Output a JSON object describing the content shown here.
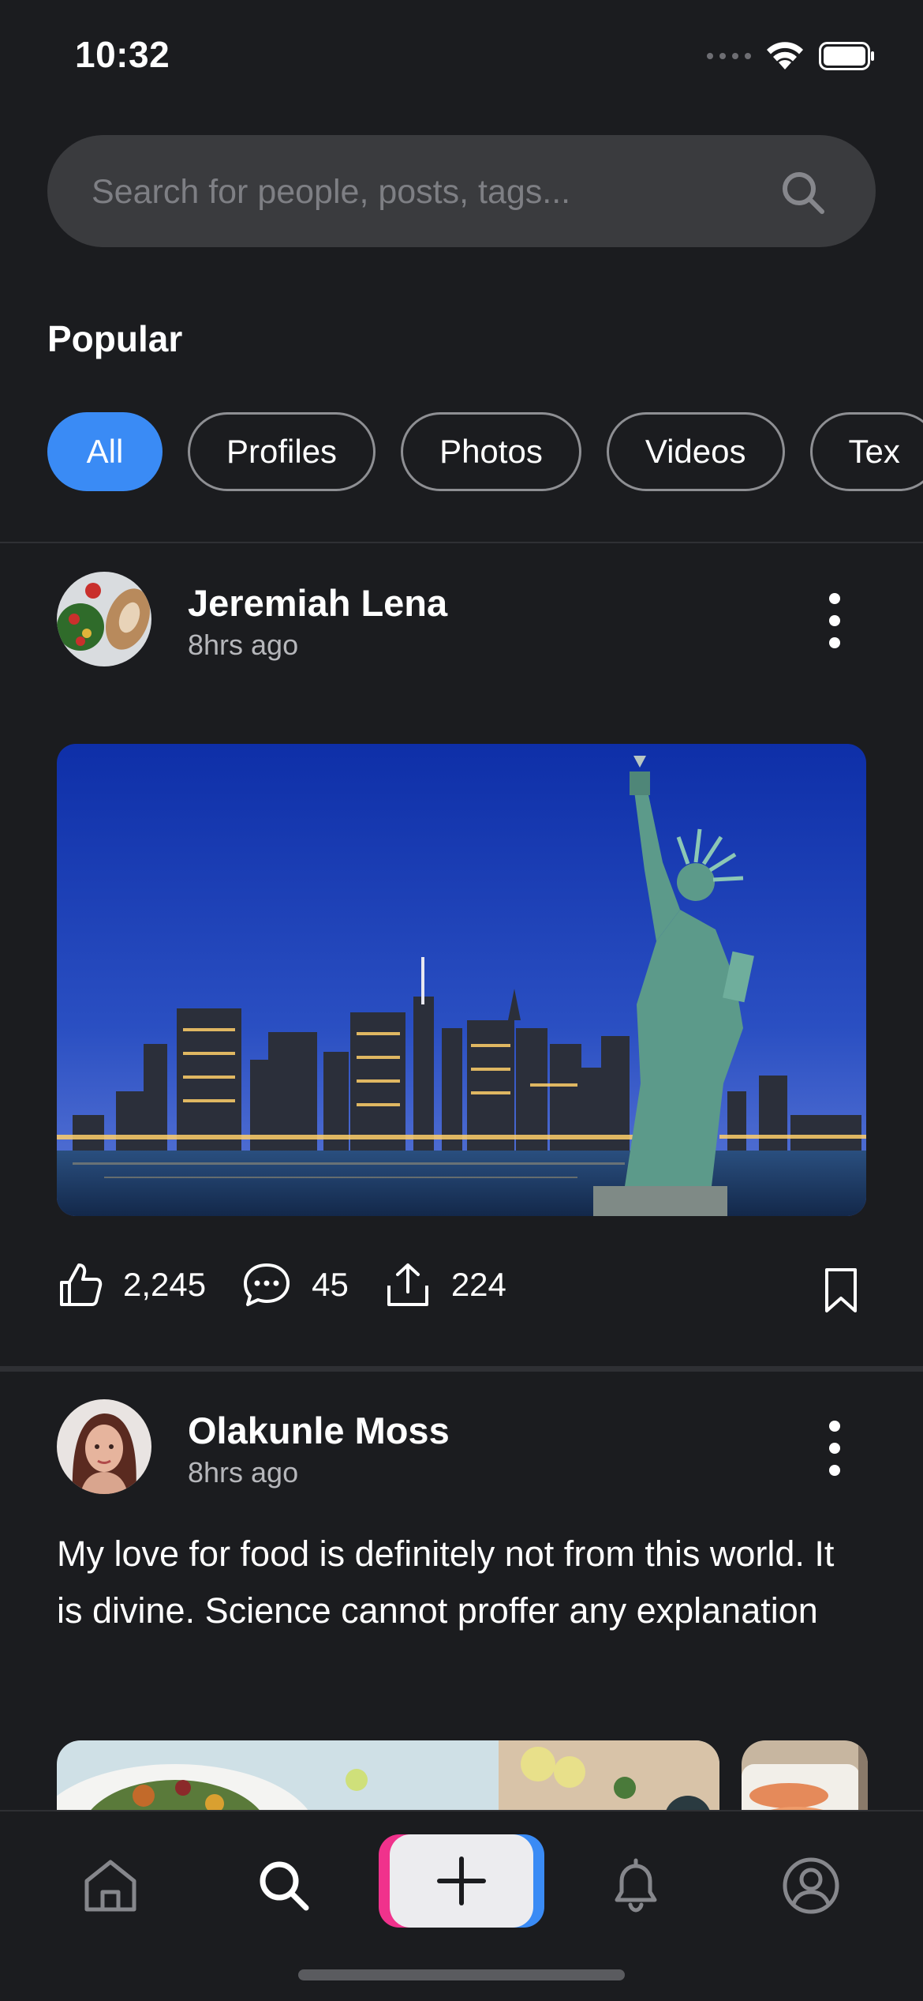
{
  "status_bar": {
    "time": "10:32"
  },
  "search": {
    "placeholder": "Search for people, posts, tags..."
  },
  "popular": {
    "title": "Popular",
    "filters": [
      "All",
      "Profiles",
      "Photos",
      "Videos",
      "Tex"
    ],
    "active_filter": "All"
  },
  "posts": [
    {
      "author": "Jeremiah Lena",
      "time": "8hrs ago",
      "likes": "2,245",
      "comments": "45",
      "shares": "224"
    },
    {
      "author": "Olakunle Moss",
      "time": "8hrs ago",
      "text": "My love for food is definitely not from this world. It is divine. Science cannot proffer any explanation"
    }
  ],
  "tab_bar": {
    "items": [
      "home-icon",
      "search-icon",
      "add-icon",
      "bell-icon",
      "profile-icon"
    ],
    "active": "search-icon"
  },
  "colors": {
    "background": "#1b1c1f",
    "accent_blue": "#3a8bf5",
    "accent_pink": "#f0328c",
    "surface": "#3a3b3e"
  }
}
